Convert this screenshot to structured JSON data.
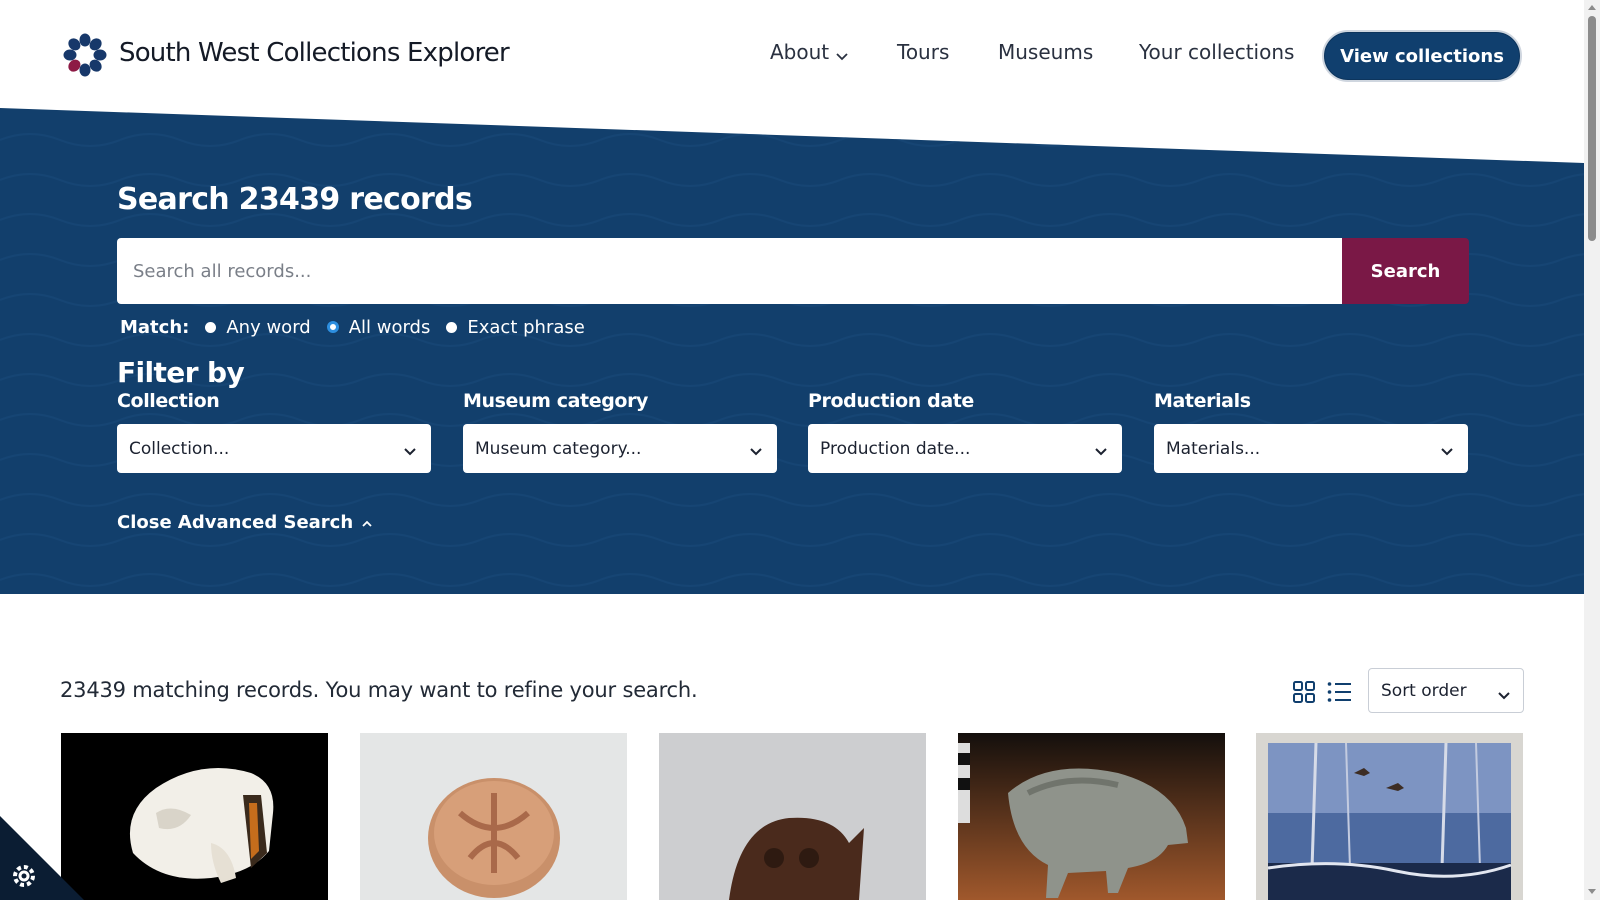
{
  "header": {
    "site_title": "South West Collections Explorer",
    "nav": {
      "about": "About",
      "tours": "Tours",
      "museums": "Museums",
      "your_collections": "Your collections"
    },
    "view_collections_button": "View collections"
  },
  "search": {
    "heading": "Search 23439 records",
    "placeholder": "Search all records...",
    "button": "Search",
    "match": {
      "label": "Match:",
      "options": [
        "Any word",
        "All words",
        "Exact phrase"
      ],
      "selected": "All words"
    }
  },
  "filters": {
    "title": "Filter by",
    "items": [
      {
        "label": "Collection",
        "value": "Collection..."
      },
      {
        "label": "Museum category",
        "value": "Museum category..."
      },
      {
        "label": "Production date",
        "value": "Production date..."
      },
      {
        "label": "Materials",
        "value": "Materials..."
      }
    ],
    "close_advanced": "Close Advanced Search"
  },
  "results": {
    "summary": "23439 matching records. You may want to refine your search.",
    "sort_label": "Sort order",
    "view_modes": [
      "grid-view-icon",
      "list-view-icon"
    ],
    "cards": [
      {
        "subject": "animal skull"
      },
      {
        "subject": "stamped clay seal"
      },
      {
        "subject": "carved head figure"
      },
      {
        "subject": "pig figurine"
      },
      {
        "subject": "painting of birds over winter marsh"
      }
    ]
  },
  "colors": {
    "brand_navy": "#103f6e",
    "hero_blue": "#123f6c",
    "search_button": "#7a1846",
    "radio_selected": "#2d8fe0",
    "logo_navy": "#17386a",
    "logo_crimson": "#8d1a45"
  }
}
